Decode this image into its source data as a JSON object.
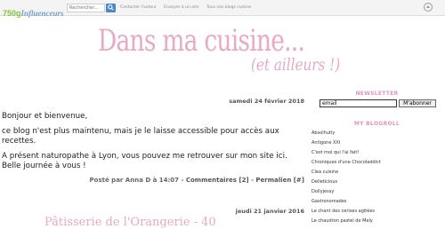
{
  "topbar": {
    "logo_number": "750g",
    "logo_brand": "Influenceurs",
    "search_placeholder": "Rechercher...",
    "links": [
      "Contacter l'auteur",
      "Envoyer à un ami",
      "Tous nos blogs cuisine"
    ]
  },
  "banner": {
    "title": "Dans ma cuisine...",
    "subtitle": "(et ailleurs !)"
  },
  "post": {
    "date": "samedi 24 février 2018",
    "paragraphs": [
      "Bonjour et bienvenue,",
      "ce blog n'est plus maintenu, mais je le laisse accessible pour accès aux recettes.",
      "A présent naturopathe à Lyon, vous pouvez me retrouver sur mon site ici. Belle journée à vous !"
    ],
    "footer_prefix": "Posté par Anna D à 14:07 - ",
    "comments_link": "Commentaires [2]",
    "separator": " - ",
    "permalink": "Permalien [#]"
  },
  "next_post": {
    "date": "jeudi 21 janvier 2016",
    "title": "Pâtisserie de l'Orangerie - 40"
  },
  "sidebar": {
    "newsletter_heading": "NEWSLETTER",
    "email_value": "email",
    "subscribe_label": "M'abonner",
    "blogroll_heading": "MY BLOGROLL",
    "blogroll": [
      "Absolhutly",
      "Antigone XXI",
      "C'est moi qui l'ai fait!",
      "Chroniques d'une Chocoladdict",
      "Clea cuisine",
      "Delleticious",
      "Dollyjessy",
      "Gastronomades",
      "Le chant des cerises agitées",
      "Le chaudron pastel de Mely"
    ]
  },
  "colors": {
    "accent": "#e7a9c4",
    "heading_pink": "#e094b8",
    "search_button": "#4d88c9"
  }
}
